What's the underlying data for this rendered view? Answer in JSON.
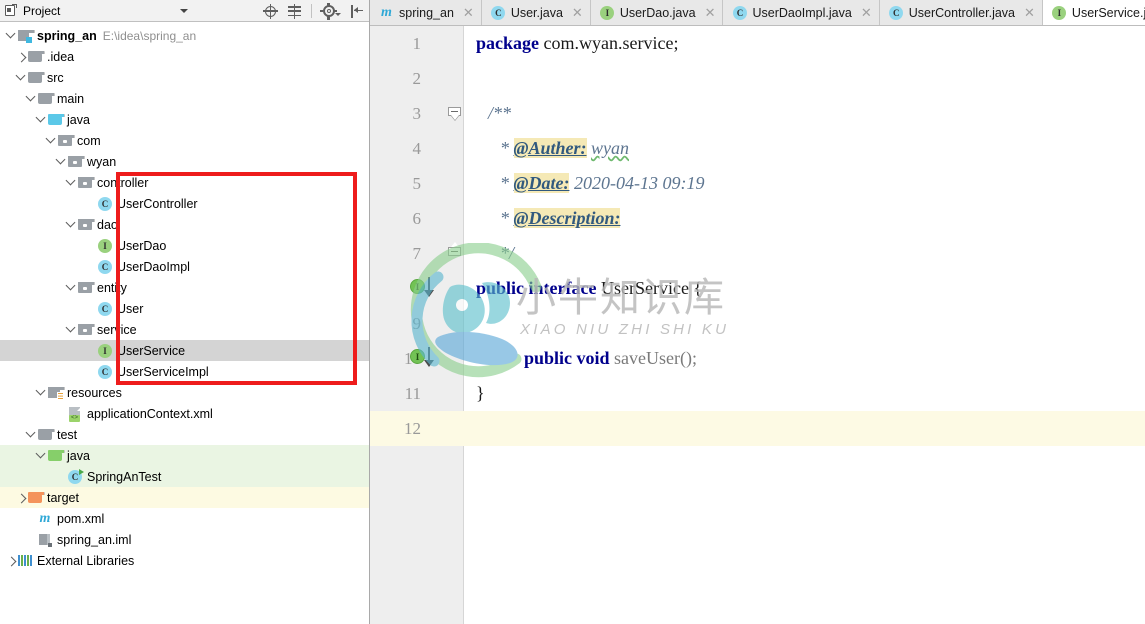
{
  "project_panel": {
    "title": "Project",
    "icons": {
      "project": "project-view-icon",
      "dropdown": "chevron-down-icon",
      "locate": "locate-target-icon",
      "collapse": "collapse-all-icon",
      "settings": "gear-icon",
      "hide": "hide-panel-icon"
    },
    "tree": [
      {
        "label": "spring_an",
        "path": "E:\\idea\\spring_an",
        "icon": "module-icon",
        "indent": 0,
        "twist": "open",
        "bold": true
      },
      {
        "label": ".idea",
        "icon": "folder-icon",
        "indent": 1,
        "twist": "closed"
      },
      {
        "label": "src",
        "icon": "folder-icon",
        "indent": 1,
        "twist": "open"
      },
      {
        "label": "main",
        "icon": "folder-icon",
        "indent": 2,
        "twist": "open"
      },
      {
        "label": "java",
        "icon": "folder-source-icon",
        "indent": 3,
        "twist": "open"
      },
      {
        "label": "com",
        "icon": "package-icon",
        "indent": 4,
        "twist": "open"
      },
      {
        "label": "wyan",
        "icon": "package-icon",
        "indent": 5,
        "twist": "open"
      },
      {
        "label": "controller",
        "icon": "package-icon",
        "indent": 6,
        "twist": "open"
      },
      {
        "label": "UserController",
        "icon": "class-icon",
        "indent": 8
      },
      {
        "label": "dao",
        "icon": "package-icon",
        "indent": 6,
        "twist": "open"
      },
      {
        "label": "UserDao",
        "icon": "interface-icon",
        "indent": 8
      },
      {
        "label": "UserDaoImpl",
        "icon": "class-icon",
        "indent": 8
      },
      {
        "label": "entity",
        "icon": "package-icon",
        "indent": 6,
        "twist": "open"
      },
      {
        "label": "User",
        "icon": "class-icon",
        "indent": 8
      },
      {
        "label": "service",
        "icon": "package-icon",
        "indent": 6,
        "twist": "open"
      },
      {
        "label": "UserService",
        "icon": "interface-icon",
        "indent": 8,
        "selected": true
      },
      {
        "label": "UserServiceImpl",
        "icon": "class-icon",
        "indent": 8
      },
      {
        "label": "resources",
        "icon": "resources-folder-icon",
        "indent": 3,
        "twist": "open"
      },
      {
        "label": "applicationContext.xml",
        "icon": "xml-file-icon",
        "indent": 5
      },
      {
        "label": "test",
        "icon": "folder-icon",
        "indent": 2,
        "twist": "open"
      },
      {
        "label": "java",
        "icon": "folder-test-source-icon",
        "indent": 3,
        "twist": "open",
        "bg": "test-source"
      },
      {
        "label": "SpringAnTest",
        "icon": "test-class-icon",
        "indent": 5,
        "bg": "test-source"
      },
      {
        "label": "target",
        "icon": "folder-excluded-icon",
        "indent": 1,
        "twist": "closed",
        "bg": "excluded"
      },
      {
        "label": "pom.xml",
        "icon": "maven-icon",
        "indent": 2
      },
      {
        "label": "spring_an.iml",
        "icon": "iml-file-icon",
        "indent": 2
      },
      {
        "label": "External Libraries",
        "icon": "libraries-icon",
        "indent": 0,
        "twist": "closed"
      }
    ],
    "annotation": {
      "type": "red-rectangle",
      "color": "#ee1c1c"
    }
  },
  "editor": {
    "tabs": [
      {
        "label": "spring_an",
        "icon": "maven-icon",
        "closable": true,
        "active": false
      },
      {
        "label": "User.java",
        "icon": "class-icon",
        "closable": true,
        "active": false
      },
      {
        "label": "UserDao.java",
        "icon": "interface-icon",
        "closable": true,
        "active": false
      },
      {
        "label": "UserDaoImpl.java",
        "icon": "class-icon",
        "closable": true,
        "active": false
      },
      {
        "label": "UserController.java",
        "icon": "class-icon",
        "closable": true,
        "active": false
      },
      {
        "label": "UserService.java",
        "icon": "interface-icon",
        "closable": false,
        "active": true
      }
    ],
    "line_numbers": [
      "1",
      "2",
      "3",
      "4",
      "5",
      "6",
      "7",
      "8",
      "9",
      "10",
      "11",
      "12"
    ],
    "current_line": "12",
    "gutter_markers": [
      {
        "line": "8",
        "icon": "implemented-interface-icon",
        "glyph": "I"
      },
      {
        "line": "10",
        "icon": "implemented-method-icon",
        "glyph": "I"
      }
    ],
    "fold_markers": [
      {
        "line": "3",
        "icon": "fold-collapse-icon"
      },
      {
        "line": "7",
        "icon": "fold-collapse-icon"
      }
    ],
    "code": {
      "l1_kw": "package",
      "l1_pkg": "com.wyan.service;",
      "l3": "/**",
      "l4_star": "*",
      "l4_tag": "@Auther:",
      "l4_val": "wyan",
      "l5_star": "*",
      "l5_tag": "@Date:",
      "l5_val": "2020-04-13 09:19",
      "l6_star": "*",
      "l6_tag": "@Description:",
      "l7": "*/",
      "l8_public": "public",
      "l8_interface": "interface",
      "l8_name": "UserService",
      "l8_brace": "{",
      "l10_public": "public",
      "l10_void": "void",
      "l10_method": "saveUser();",
      "l11": "}"
    }
  },
  "watermark": {
    "cn": "小牛知识库",
    "en": "XIAO NIU ZHI SHI KU",
    "logo": "niu-logo-icon"
  }
}
